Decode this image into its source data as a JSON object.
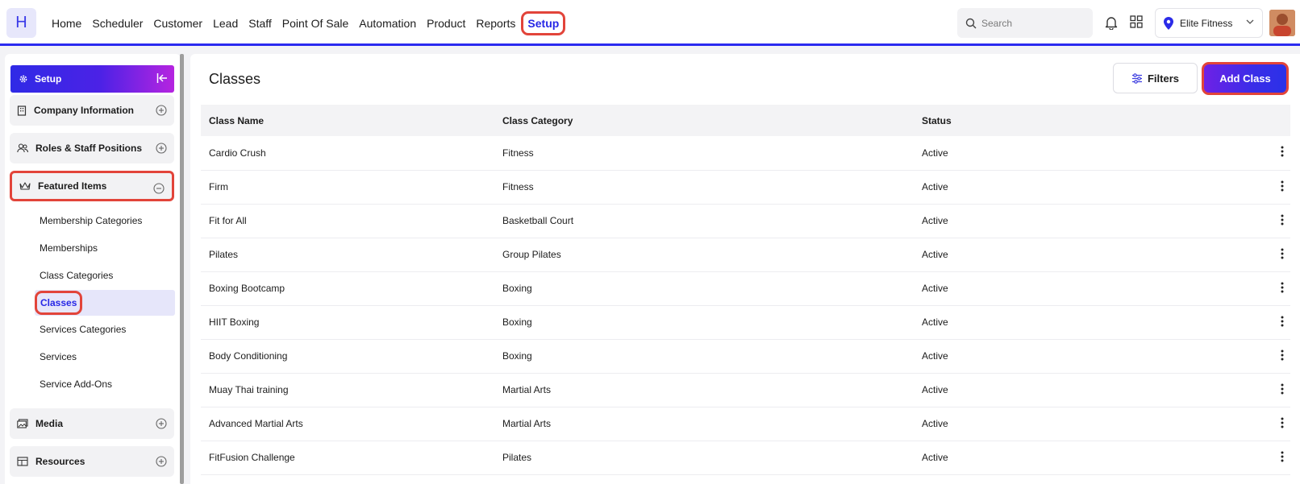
{
  "app": {
    "logo_letter": "H"
  },
  "nav": {
    "items": [
      "Home",
      "Scheduler",
      "Customer",
      "Lead",
      "Staff",
      "Point Of Sale",
      "Automation",
      "Product",
      "Reports"
    ],
    "active": "Setup"
  },
  "header": {
    "search_placeholder": "Search",
    "location": "Elite Fitness"
  },
  "sidebar": {
    "title": "Setup",
    "groups": {
      "company": "Company Information",
      "roles": "Roles & Staff Positions",
      "featured": "Featured Items",
      "media": "Media",
      "resources": "Resources"
    },
    "featured_items": [
      "Membership Categories",
      "Memberships",
      "Class Categories",
      "Classes",
      "Services Categories",
      "Services",
      "Service Add-Ons"
    ],
    "active_item": "Classes"
  },
  "main": {
    "title": "Classes",
    "filters_label": "Filters",
    "add_label": "Add Class",
    "columns": [
      "Class Name",
      "Class Category",
      "Status"
    ],
    "rows": [
      [
        "Cardio Crush",
        "Fitness",
        "Active"
      ],
      [
        "Firm",
        "Fitness",
        "Active"
      ],
      [
        "Fit for All",
        "Basketball Court",
        "Active"
      ],
      [
        "Pilates",
        "Group Pilates",
        "Active"
      ],
      [
        "Boxing Bootcamp",
        "Boxing",
        "Active"
      ],
      [
        "HIIT Boxing",
        "Boxing",
        "Active"
      ],
      [
        "Body Conditioning",
        "Boxing",
        "Active"
      ],
      [
        "Muay Thai training",
        "Martial Arts",
        "Active"
      ],
      [
        "Advanced Martial Arts",
        "Martial Arts",
        "Active"
      ],
      [
        "FitFusion Challenge",
        "Pilates",
        "Active"
      ]
    ]
  },
  "colors": {
    "accent": "#2727e6",
    "highlight": "#e2443a",
    "gradient_end": "#b624e0"
  },
  "icons": {
    "search": "search-icon",
    "bell": "bell-icon",
    "apps": "apps-grid-icon",
    "location": "location-pin-icon",
    "gear": "gear-icon",
    "collapse": "collapse-left-icon",
    "building": "building-icon",
    "users": "users-icon",
    "crown": "crown-icon",
    "media": "media-icon",
    "resources": "resources-icon",
    "plus": "plus-circle-icon",
    "minus": "minus-circle-icon",
    "filters": "sliders-icon",
    "kebab": "kebab-menu-icon"
  }
}
